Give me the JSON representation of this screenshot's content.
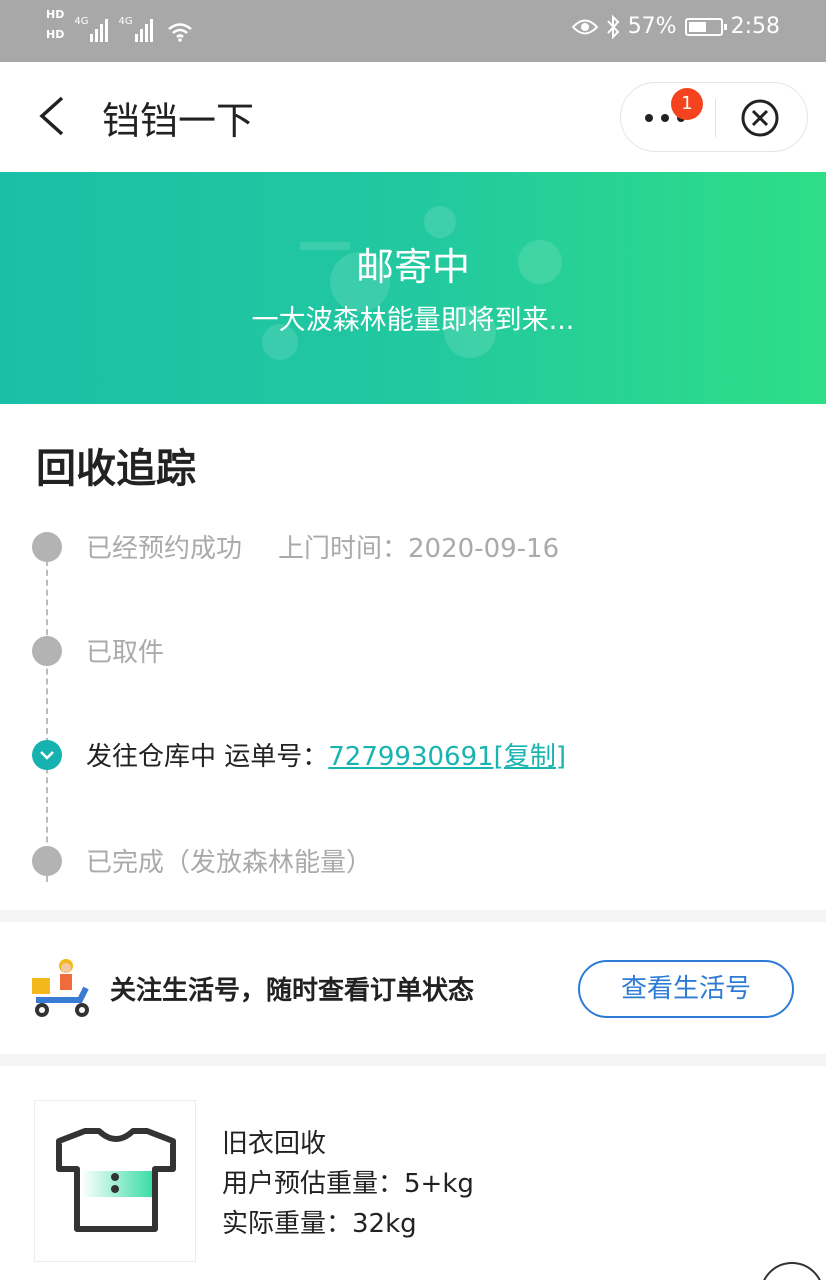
{
  "status_bar": {
    "hd1": "HD",
    "hd2": "HD",
    "net1": "4G",
    "net2": "4G",
    "battery_percent": "57%",
    "battery_level": 0.57,
    "time": "2:58"
  },
  "nav": {
    "title": "铛铛一下",
    "badge_count": "1"
  },
  "banner": {
    "title": "邮寄中",
    "subtitle": "一大波森林能量即将到来..."
  },
  "tracking": {
    "title": "回收追踪",
    "steps": [
      {
        "label": "已经预约成功",
        "extra": "上门时间：2020-09-16"
      },
      {
        "label": "已取件"
      },
      {
        "label": "发往仓库中 运单号：",
        "link": "7279930691[复制]"
      },
      {
        "label": "已完成（发放森林能量）"
      }
    ]
  },
  "follow": {
    "text": "关注生活号，随时查看订单状态",
    "button": "查看生活号"
  },
  "item": {
    "name": "旧衣回收",
    "estimated": "用户预估重量：5+kg",
    "actual": "实际重量：32kg"
  },
  "colors": {
    "accent": "#19b3b0",
    "button_blue": "#2e7bd6",
    "banner_start": "#1bbfa6",
    "banner_end": "#2ede86",
    "badge": "#f5431f"
  }
}
